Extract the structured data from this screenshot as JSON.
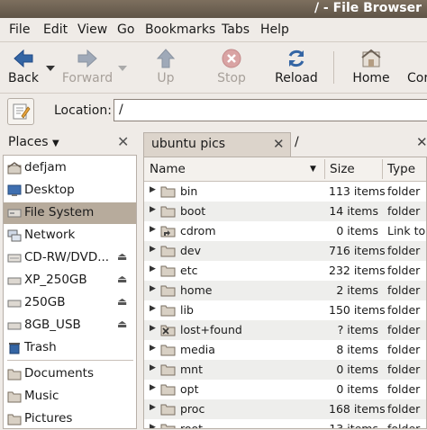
{
  "window": {
    "title": "/ - File Browser"
  },
  "menu": [
    "File",
    "Edit",
    "View",
    "Go",
    "Bookmarks",
    "Tabs",
    "Help"
  ],
  "toolbar": {
    "back": "Back",
    "forward": "Forward",
    "up": "Up",
    "stop": "Stop",
    "reload": "Reload",
    "home": "Home",
    "computer": "Cor"
  },
  "location": {
    "label": "Location:",
    "value": "/"
  },
  "sidebar": {
    "header": "Places",
    "items": [
      {
        "label": "defjam",
        "icon": "home-folder-icon"
      },
      {
        "label": "Desktop",
        "icon": "desktop-icon"
      },
      {
        "label": "File System",
        "icon": "filesystem-icon",
        "selected": true
      },
      {
        "label": "Network",
        "icon": "network-icon"
      },
      {
        "label": "CD-RW/DVD...",
        "icon": "optical-drive-icon",
        "eject": true
      },
      {
        "label": "XP_250GB",
        "icon": "drive-icon",
        "eject": true
      },
      {
        "label": "250GB",
        "icon": "drive-icon",
        "eject": true
      },
      {
        "label": "8GB_USB",
        "icon": "drive-icon",
        "eject": true
      },
      {
        "label": "Trash",
        "icon": "trash-icon"
      }
    ],
    "bookmarks": [
      {
        "label": "Documents",
        "icon": "folder-icon"
      },
      {
        "label": "Music",
        "icon": "folder-icon"
      },
      {
        "label": "Pictures",
        "icon": "folder-icon"
      }
    ]
  },
  "tabs": [
    {
      "label": "ubuntu pics"
    },
    {
      "label": "/"
    }
  ],
  "columns": {
    "name": "Name",
    "size": "Size",
    "type": "Type"
  },
  "files": [
    {
      "name": "bin",
      "size": "113 items",
      "type": "folder"
    },
    {
      "name": "boot",
      "size": "14 items",
      "type": "folder"
    },
    {
      "name": "cdrom",
      "size": "0 items",
      "type": "Link to f"
    },
    {
      "name": "dev",
      "size": "716 items",
      "type": "folder"
    },
    {
      "name": "etc",
      "size": "232 items",
      "type": "folder"
    },
    {
      "name": "home",
      "size": "2 items",
      "type": "folder"
    },
    {
      "name": "lib",
      "size": "150 items",
      "type": "folder"
    },
    {
      "name": "lost+found",
      "size": "? items",
      "type": "folder"
    },
    {
      "name": "media",
      "size": "8 items",
      "type": "folder"
    },
    {
      "name": "mnt",
      "size": "0 items",
      "type": "folder"
    },
    {
      "name": "opt",
      "size": "0 items",
      "type": "folder"
    },
    {
      "name": "proc",
      "size": "168 items",
      "type": "folder"
    },
    {
      "name": "root",
      "size": "13 items",
      "type": "folder"
    }
  ],
  "colors": {
    "titlebar": "#6f6252",
    "selection": "#b7ab9c",
    "accent_blue": "#3465a4",
    "stop_red": "#cc3b3b"
  }
}
